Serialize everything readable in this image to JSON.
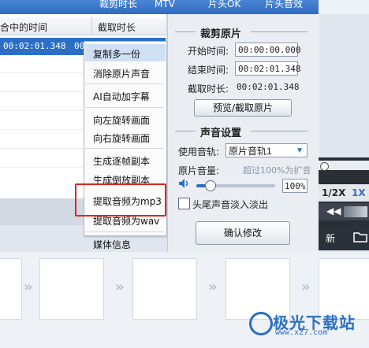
{
  "top_tabs": [
    "合中的时间",
    "裁剪时长",
    "MTV",
    "片头OK",
    "片头音效"
  ],
  "list": {
    "col_time": "合中的时间",
    "col_duration": "截取时长",
    "selected_time": "00:02:01.348",
    "selected_extra": "00"
  },
  "menu": {
    "items": [
      "复制多一份",
      "消除原片声音",
      "AI自动加字幕",
      "向左旋转画面",
      "向右旋转画面",
      "生成逐帧副本",
      "生成倒放副本",
      "提取音频为mp3",
      "提取音频为wav",
      "媒体信息"
    ]
  },
  "crop": {
    "title": "裁剪原片",
    "start_label": "开始时间:",
    "start_value": "00:00:00.000",
    "end_label": "结束时间:",
    "end_value": "00:02:01.348",
    "duration_label": "截取时长:",
    "duration_value": "00:02:01.348",
    "preview_button": "预览/截取原片"
  },
  "audio": {
    "title": "声音设置",
    "track_label": "使用音轨:",
    "track_value": "原片音轨1",
    "volume_label": "原片音量:",
    "volume_hint": "超过100%为扩音",
    "volume_value": "100%",
    "fade_label": "头尾声音淡入淡出",
    "confirm_button": "确认修改"
  },
  "player": {
    "speed_half": "1/2X",
    "speed_one": "1X",
    "new_label": "新"
  },
  "watermark": {
    "text": "极光下载站",
    "url": "www.xz7.com"
  },
  "colors": {
    "accent": "#2b6fc4",
    "highlight_border": "#e0261c"
  }
}
